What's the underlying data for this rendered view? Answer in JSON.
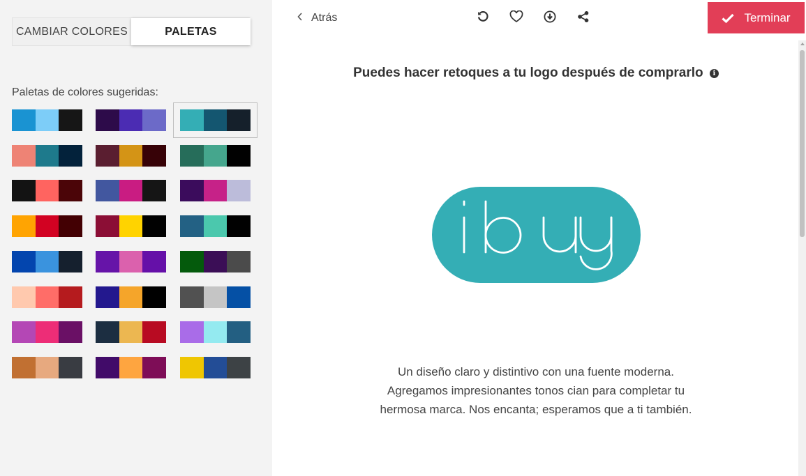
{
  "sidebar": {
    "tabs": [
      {
        "label": "CAMBIAR COLORES",
        "active": false
      },
      {
        "label": "PALETAS",
        "active": true
      }
    ],
    "palettes_label": "Paletas de colores sugeridas:",
    "palettes": [
      {
        "colors": [
          "#1a93d2",
          "#7dcdf8",
          "#161616"
        ]
      },
      {
        "colors": [
          "#2d0b4a",
          "#4b2cb3",
          "#6c6ac8"
        ]
      },
      {
        "colors": [
          "#34aeb5",
          "#145670",
          "#15202b"
        ],
        "selected": true
      },
      {
        "colors": [
          "#ee8375",
          "#1e7a8c",
          "#03223b"
        ]
      },
      {
        "colors": [
          "#5a1e30",
          "#d49416",
          "#370207"
        ]
      },
      {
        "colors": [
          "#266d5a",
          "#45a68d",
          "#010101"
        ]
      },
      {
        "colors": [
          "#131313",
          "#ff6460",
          "#4b0508"
        ]
      },
      {
        "colors": [
          "#42579f",
          "#c91c82",
          "#151515"
        ]
      },
      {
        "colors": [
          "#3b0c5c",
          "#c62288",
          "#bcbcda"
        ]
      },
      {
        "colors": [
          "#ffa402",
          "#d20222",
          "#430003"
        ]
      },
      {
        "colors": [
          "#8b0e35",
          "#ffd300",
          "#010101"
        ]
      },
      {
        "colors": [
          "#236184",
          "#4bc8ad",
          "#010101"
        ]
      },
      {
        "colors": [
          "#0345ae",
          "#3a93de",
          "#15202e"
        ]
      },
      {
        "colors": [
          "#6614a8",
          "#db61ad",
          "#6510a8"
        ]
      },
      {
        "colors": [
          "#045a0c",
          "#3b0e56",
          "#4b4b4b"
        ]
      },
      {
        "colors": [
          "#ffc9ae",
          "#ff6d68",
          "#b51b1e"
        ]
      },
      {
        "colors": [
          "#23188e",
          "#f5a52a",
          "#000000"
        ]
      },
      {
        "colors": [
          "#515151",
          "#c5c5c5",
          "#0550a5"
        ]
      },
      {
        "colors": [
          "#b447b5",
          "#ed2d77",
          "#6a1065"
        ]
      },
      {
        "colors": [
          "#1c2e41",
          "#ecb751",
          "#b80b22"
        ]
      },
      {
        "colors": [
          "#a96ce8",
          "#94eaf0",
          "#235f82"
        ]
      },
      {
        "colors": [
          "#c17032",
          "#e7a97f",
          "#393c42"
        ]
      },
      {
        "colors": [
          "#410b69",
          "#fea540",
          "#7e0d57"
        ]
      },
      {
        "colors": [
          "#efc602",
          "#234d96",
          "#3d4245"
        ]
      }
    ]
  },
  "header": {
    "back_label": "Atrás",
    "icons": [
      "undo-icon",
      "heart-icon",
      "download-icon",
      "share-icon"
    ],
    "finish_label": "Terminar"
  },
  "main": {
    "headline": "Puedes hacer retoques a tu logo después de comprarlo",
    "logo_text": "ibuy",
    "logo_color": "#34aeb5",
    "description": "Un diseño claro y distintivo con una fuente moderna. Agregamos impresionantes tonos cian para completar tu hermosa marca. Nos encanta; esperamos que a ti también."
  },
  "colors": {
    "accent": "#e23e57",
    "sidebar_bg": "#f3f3f3"
  }
}
